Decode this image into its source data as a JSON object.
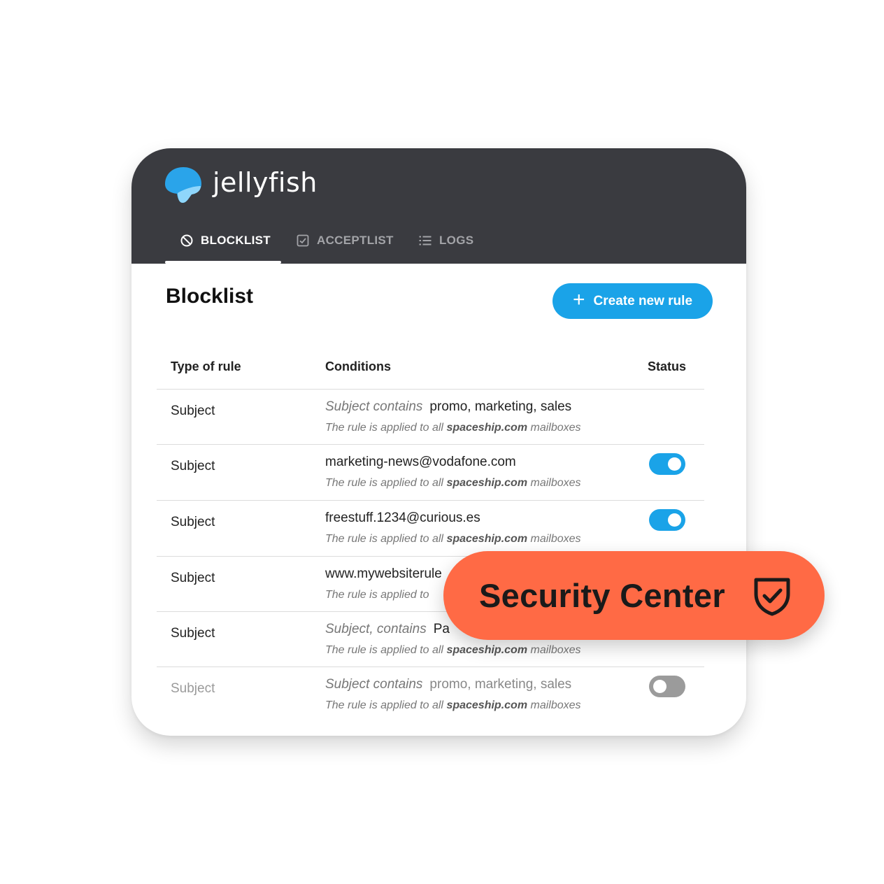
{
  "app": {
    "brand": "jellyfish",
    "accent_color": "#1aa3e8",
    "header_color": "#3a3b40"
  },
  "tabs": [
    {
      "label": "BLOCKLIST",
      "icon": "block-icon",
      "active": true
    },
    {
      "label": "ACCEPTLIST",
      "icon": "checkbox-icon",
      "active": false
    },
    {
      "label": "LOGS",
      "icon": "list-icon",
      "active": false
    }
  ],
  "main": {
    "title": "Blocklist",
    "create_button_label": "Create new rule",
    "create_button_icon": "plus-icon"
  },
  "table": {
    "headers": [
      "Type of rule",
      "Conditions",
      "Status"
    ],
    "rows": [
      {
        "type": "Subject",
        "cond_prefix": "Subject contains",
        "cond_value": "promo, marketing, sales",
        "note_prefix": "The rule is applied to all",
        "note_domain": "spaceship.com",
        "note_suffix": "mailboxes",
        "status": null
      },
      {
        "type": "Subject",
        "cond_prefix": "",
        "cond_value": "marketing-news@vodafone.com",
        "note_prefix": "The rule is applied to all",
        "note_domain": "spaceship.com",
        "note_suffix": "mailboxes",
        "status": "on"
      },
      {
        "type": "Subject",
        "cond_prefix": "",
        "cond_value": "freestuff.1234@curious.es",
        "note_prefix": "The rule is applied to all",
        "note_domain": "spaceship.com",
        "note_suffix": "mailboxes",
        "status": "on"
      },
      {
        "type": "Subject",
        "cond_prefix": "",
        "cond_value": "www.mywebsiterule",
        "note_prefix": "The rule is applied to",
        "note_domain": "",
        "note_suffix": "",
        "status": null
      },
      {
        "type": "Subject",
        "cond_prefix": "Subject, contains",
        "cond_value": "Pa",
        "note_prefix": "The rule is applied to all",
        "note_domain": "spaceship.com",
        "note_suffix": "mailboxes",
        "status": null
      },
      {
        "type": "Subject",
        "cond_prefix": "Subject contains",
        "cond_value": "promo, marketing, sales",
        "note_prefix": "The rule is applied to all",
        "note_domain": "spaceship.com",
        "note_suffix": "mailboxes",
        "status": "off"
      }
    ]
  },
  "badge": {
    "label": "Security Center",
    "icon": "shield-check-icon",
    "color": "#ff6a45"
  }
}
